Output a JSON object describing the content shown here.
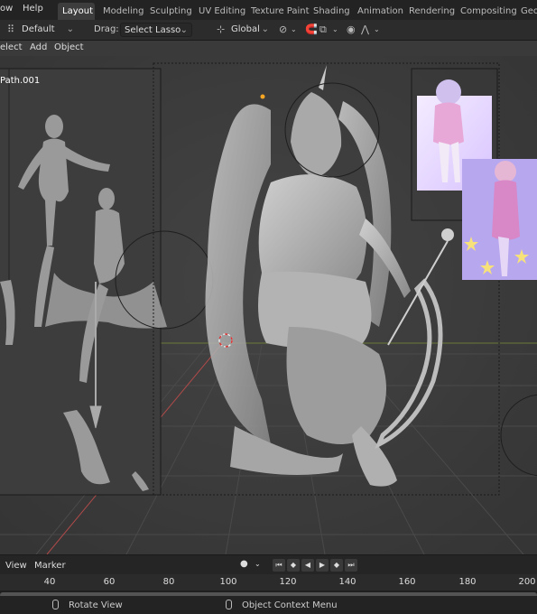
{
  "menubar": {
    "items": [
      "ow",
      "Help"
    ],
    "tabs": [
      "Layout",
      "Modeling",
      "Sculpting",
      "UV Editing",
      "Texture Paint",
      "Shading",
      "Animation",
      "Rendering",
      "Compositing",
      "Geo"
    ],
    "active_tab": "Layout"
  },
  "toolbar": {
    "orientation": "Default",
    "drag_label": "Drag:",
    "drag_value": "Select Lasso",
    "transform_orientation": "Global"
  },
  "viewport_header": {
    "menus": [
      "elect",
      "Add",
      "Object"
    ]
  },
  "viewport": {
    "object_label": "Path.001"
  },
  "timeline": {
    "menus": [
      "View",
      "Marker"
    ],
    "ticks": [
      "40",
      "60",
      "80",
      "100",
      "120",
      "140",
      "160",
      "180",
      "200"
    ]
  },
  "statusbar": {
    "left_hint": "Rotate View",
    "right_hint": "Object Context Menu"
  },
  "colors": {
    "header_bg": "#232323",
    "active_tab_bg": "#3d3d3d",
    "viewport_bg": "#3b3b3b",
    "origin_dot": "#f5a623",
    "x_axis_line": "#b04a4a"
  }
}
